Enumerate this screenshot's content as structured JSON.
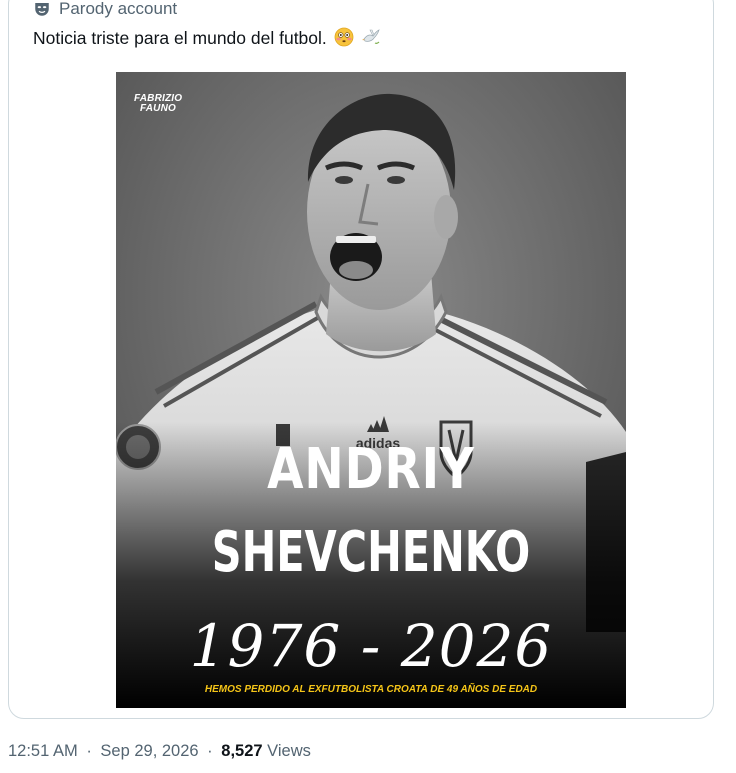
{
  "post": {
    "account_label": "Parody account",
    "text": "Noticia triste para el mundo del futbol.",
    "emojis": [
      "flushed-face",
      "dove"
    ],
    "image": {
      "brand_line1": "FABRIZIO",
      "brand_line2": "FAUNO",
      "headline_line1": "ANDRIY",
      "headline_line2": "SHEVCHENKO",
      "years": "1976 - 2026",
      "caption": "HEMOS PERDIDO AL EXFUTBOLISTA CROATA DE 49 AÑOS DE EDAD",
      "jersey_brand": "adidas"
    }
  },
  "meta": {
    "time": "12:51 AM",
    "separator": "·",
    "date": "Sep 29, 2026",
    "views_count": "8,527",
    "views_label": "Views"
  },
  "colors": {
    "secondary_text": "#536471",
    "primary_text": "#0f1419",
    "border": "#cfd9de",
    "caption_yellow": "#f5c518"
  }
}
